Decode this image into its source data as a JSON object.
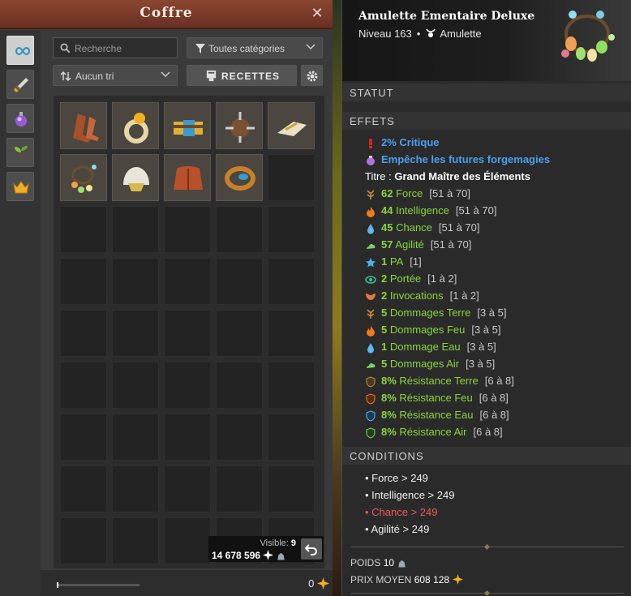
{
  "chest": {
    "title": "Coffre",
    "search_placeholder": "Recherche",
    "category_filter": "Toutes catégories",
    "sort": "Aucun tri",
    "recipes_label": "RECETTES",
    "visible_label": "Visible:",
    "visible_count": "9",
    "kamas_total": "14 678 596",
    "kamas_bottom": "0",
    "side_tabs": [
      "infinity-icon",
      "weapon-icon",
      "potion-icon",
      "resource-icon",
      "crown-icon"
    ],
    "items": [
      "boots-item",
      "ring-item",
      "belt-item",
      "shield-item",
      "weapon-item",
      "amulet-item",
      "hat-item",
      "cape-item",
      "belt-ring-item"
    ]
  },
  "item": {
    "name": "Amulette Ementaire Deluxe",
    "level": "Niveau 163",
    "type": "Amulette",
    "sections": {
      "status": "STATUT",
      "effects": "EFFETS",
      "conditions": "CONDITIONS"
    },
    "special_effects": [
      {
        "text": "2% Critique",
        "icon": "critical-icon",
        "color": "#4aa0f0"
      },
      {
        "text": "Empêche les futures forgemagies",
        "icon": "potion-icon",
        "color": "#4aa0f0"
      }
    ],
    "title_line": {
      "label": "Titre :",
      "value": "Grand Maître des Éléments"
    },
    "effects": [
      {
        "value": "62",
        "name": "Force",
        "range": "[51 à 70]",
        "icon": "earth-icon"
      },
      {
        "value": "44",
        "name": "Intelligence",
        "range": "[51 à 70]",
        "icon": "fire-icon"
      },
      {
        "value": "45",
        "name": "Chance",
        "range": "[51 à 70]",
        "icon": "water-icon"
      },
      {
        "value": "57",
        "name": "Agilité",
        "range": "[51 à 70]",
        "icon": "air-icon"
      },
      {
        "value": "1",
        "name": "PA",
        "range": "[1]",
        "icon": "star-icon"
      },
      {
        "value": "2",
        "name": "Portée",
        "range": "[1 à 2]",
        "icon": "eye-icon"
      },
      {
        "value": "2",
        "name": "Invocations",
        "range": "[1 à 2]",
        "icon": "summon-icon"
      },
      {
        "value": "5",
        "name": "Dommages Terre",
        "range": "[3 à 5]",
        "icon": "earth-icon"
      },
      {
        "value": "5",
        "name": "Dommages Feu",
        "range": "[3 à 5]",
        "icon": "fire-icon"
      },
      {
        "value": "1",
        "name": "Dommage Eau",
        "range": "[3 à 5]",
        "icon": "water-icon"
      },
      {
        "value": "5",
        "name": "Dommages Air",
        "range": "[3 à 5]",
        "icon": "air-icon"
      },
      {
        "value": "8%",
        "name": "Résistance Terre",
        "range": "[6 à 8]",
        "icon": "earth-shield-icon"
      },
      {
        "value": "8%",
        "name": "Résistance Feu",
        "range": "[6 à 8]",
        "icon": "fire-shield-icon"
      },
      {
        "value": "8%",
        "name": "Résistance Eau",
        "range": "[6 à 8]",
        "icon": "water-shield-icon"
      },
      {
        "value": "8%",
        "name": "Résistance Air",
        "range": "[6 à 8]",
        "icon": "air-shield-icon"
      }
    ],
    "conditions": [
      {
        "text": "• Force > 249",
        "met": true
      },
      {
        "text": "• Intelligence > 249",
        "met": true
      },
      {
        "text": "• Chance > 249",
        "met": false
      },
      {
        "text": "• Agilité > 249",
        "met": true
      }
    ],
    "weight_label": "POIDS",
    "weight": "10",
    "avg_price_label": "PRIX MOYEN",
    "avg_price": "608 128"
  },
  "colors": {
    "effect_green": "#8ad43e",
    "special_blue": "#4aa0f0",
    "condition_fail": "#ef5a5a",
    "header_brown": "#7a3a28"
  }
}
